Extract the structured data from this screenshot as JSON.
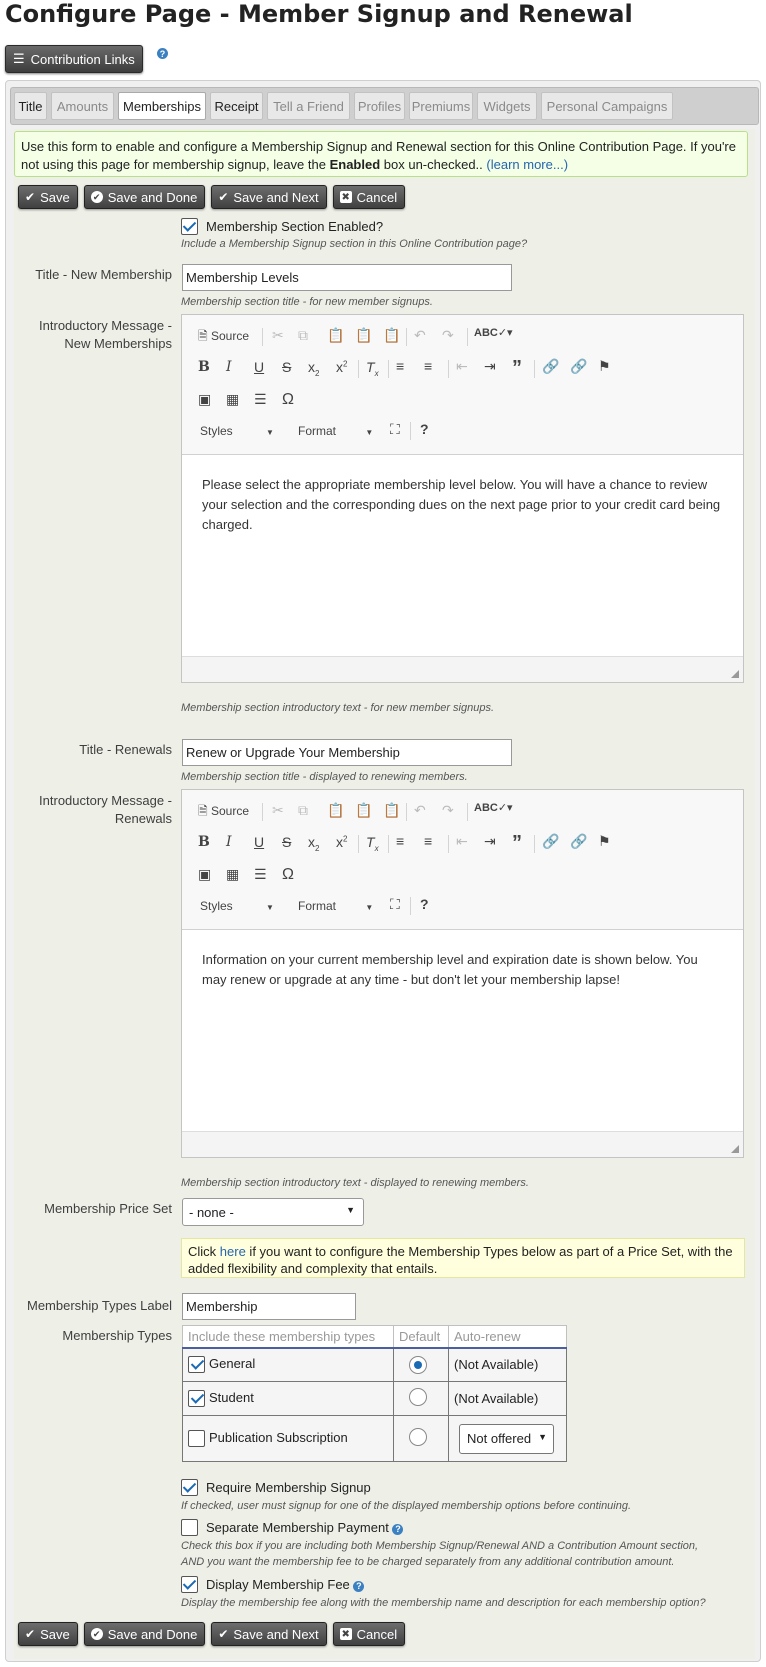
{
  "page": {
    "title": "Configure Page - Member Signup and Renewal"
  },
  "links_button": {
    "label": "Contribution Links"
  },
  "tabs": [
    {
      "label": "Title",
      "state": "enabled"
    },
    {
      "label": "Amounts",
      "state": "disabled"
    },
    {
      "label": "Memberships",
      "state": "active"
    },
    {
      "label": "Receipt",
      "state": "enabled"
    },
    {
      "label": "Tell a Friend",
      "state": "disabled"
    },
    {
      "label": "Profiles",
      "state": "disabled"
    },
    {
      "label": "Premiums",
      "state": "disabled"
    },
    {
      "label": "Widgets",
      "state": "disabled"
    },
    {
      "label": "Personal Campaigns",
      "state": "disabled"
    }
  ],
  "help": {
    "text_1": "Use this form to enable and configure a Membership Signup and Renewal section for this Online Contribution Page. If you're not using this page for membership signup, leave the ",
    "bold": "Enabled",
    "text_2": " box un-checked.. ",
    "link": "(learn more...)"
  },
  "buttons": {
    "save": "Save",
    "save_done": "Save and Done",
    "save_next": "Save and Next",
    "cancel": "Cancel"
  },
  "section_enabled": {
    "label": "Membership Section Enabled?",
    "desc": "Include a Membership Signup section in this Online Contribution page?"
  },
  "new_title": {
    "label": "Title - New Membership",
    "value": "Membership Levels",
    "desc": "Membership section title - for new member signups."
  },
  "new_intro": {
    "label_1": "Introductory Message -",
    "label_2": "New Memberships",
    "content": "Please select the appropriate membership level below. You will have a chance to review your selection and the corresponding dues on the next page prior to your credit card being charged.",
    "desc": "Membership section introductory text - for new member signups."
  },
  "renew_title": {
    "label": "Title - Renewals",
    "value": "Renew or Upgrade Your Membership",
    "desc": "Membership section title - displayed to renewing members."
  },
  "renew_intro": {
    "label_1": "Introductory Message -",
    "label_2": "Renewals",
    "content": "Information on your current membership level and expiration date is shown below. You may renew or upgrade at any time - but don't let your membership lapse!",
    "desc": "Membership section introductory text - displayed to renewing members."
  },
  "editor": {
    "source": "Source",
    "styles": "Styles",
    "format": "Format"
  },
  "price_set": {
    "label": "Membership Price Set",
    "value": "- none -",
    "note_1": "Click ",
    "note_link": "here",
    "note_2": " if you want to configure the Membership Types below as part of a Price Set, with the added flexibility and complexity that entails."
  },
  "types_label": {
    "label": "Membership Types Label",
    "value": "Membership"
  },
  "types": {
    "label": "Membership Types",
    "headers": [
      "Include these membership types",
      "Default",
      "Auto-renew"
    ],
    "rows": [
      {
        "name": "General",
        "included": true,
        "default": true,
        "auto_renew": "(Not Available)"
      },
      {
        "name": "Student",
        "included": true,
        "default": false,
        "auto_renew": "(Not Available)"
      },
      {
        "name": "Publication Subscription",
        "included": false,
        "default": false,
        "auto_renew": "Not offered"
      }
    ]
  },
  "require_signup": {
    "label": "Require Membership Signup",
    "desc": "If checked, user must signup for one of the displayed membership options before continuing."
  },
  "separate_payment": {
    "label": "Separate Membership Payment",
    "desc_1": "Check this box if you are including both Membership Signup/Renewal AND a Contribution Amount section,",
    "desc_2": "AND you want the membership fee to be charged separately from any additional contribution amount."
  },
  "display_fee": {
    "label": "Display Membership Fee",
    "desc": "Display the membership fee along with the membership name and description for each membership option?"
  }
}
